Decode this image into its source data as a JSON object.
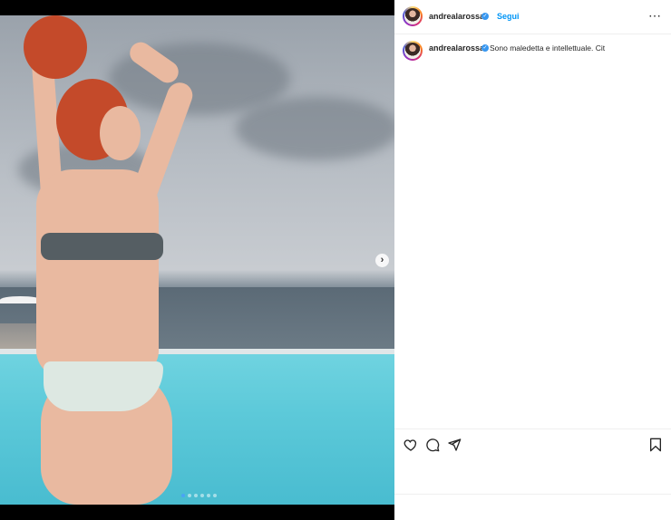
{
  "post": {
    "username": "andrealarossa",
    "verified_icon": "verified-badge-icon",
    "dot_separator": "•",
    "follow_label": "Segui",
    "more_icon": "⋯",
    "caption": "Sono maledetta e intellettuale. Cit"
  },
  "media": {
    "next_icon": "›",
    "carousel_count": 6,
    "carousel_active_index": 0
  },
  "actions": {
    "like_icon": "heart-icon",
    "comment_icon": "comment-icon",
    "share_icon": "share-icon",
    "save_icon": "bookmark-icon"
  },
  "colors": {
    "accent": "#0095f6",
    "verified": "#3897f0",
    "text": "#262626"
  }
}
